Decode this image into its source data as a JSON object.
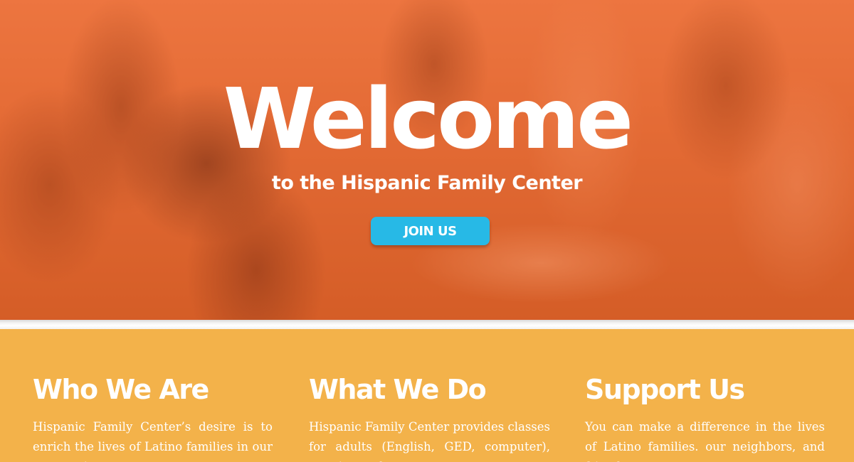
{
  "hero": {
    "title": "Welcome",
    "subtitle": "to the Hispanic Family Center",
    "button_label": "JOIN US",
    "button_color": "#27b9e6",
    "overlay_color": "#e86a30"
  },
  "info": {
    "background_color": "#f3b24a",
    "columns": [
      {
        "heading": "Who We Are",
        "text": "Hispanic Family Center’s desire is to enrich the lives of Latino families in our community"
      },
      {
        "heading": "What We Do",
        "text": "Hispanic Family Center provides classes for adults (English, GED, computer), tutoring and"
      },
      {
        "heading": "Support Us",
        "text": "You can make a difference in the lives of Latino families. our neighbors, and friends."
      }
    ]
  }
}
